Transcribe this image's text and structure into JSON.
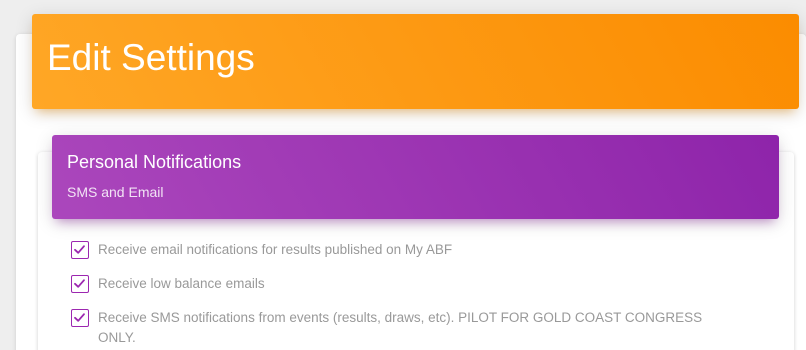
{
  "header": {
    "title": "Edit Settings"
  },
  "notifications": {
    "title": "Personal Notifications",
    "subtitle": "SMS and Email",
    "options": [
      {
        "label": "Receive email notifications for results published on My ABF",
        "checked": true
      },
      {
        "label": "Receive low balance emails",
        "checked": true
      },
      {
        "label": "Receive SMS notifications from events (results, draws, etc). PILOT FOR GOLD COAST CONGRESS ONLY.",
        "checked": true
      }
    ]
  },
  "colors": {
    "header_gradient": [
      "#ffa726",
      "#fb8c00"
    ],
    "subheader_gradient": [
      "#ab47bc",
      "#8e24aa"
    ],
    "checkbox_accent": "#9c27b0",
    "label_text": "#999999"
  },
  "icons": {
    "checkbox_check": "check-icon"
  }
}
